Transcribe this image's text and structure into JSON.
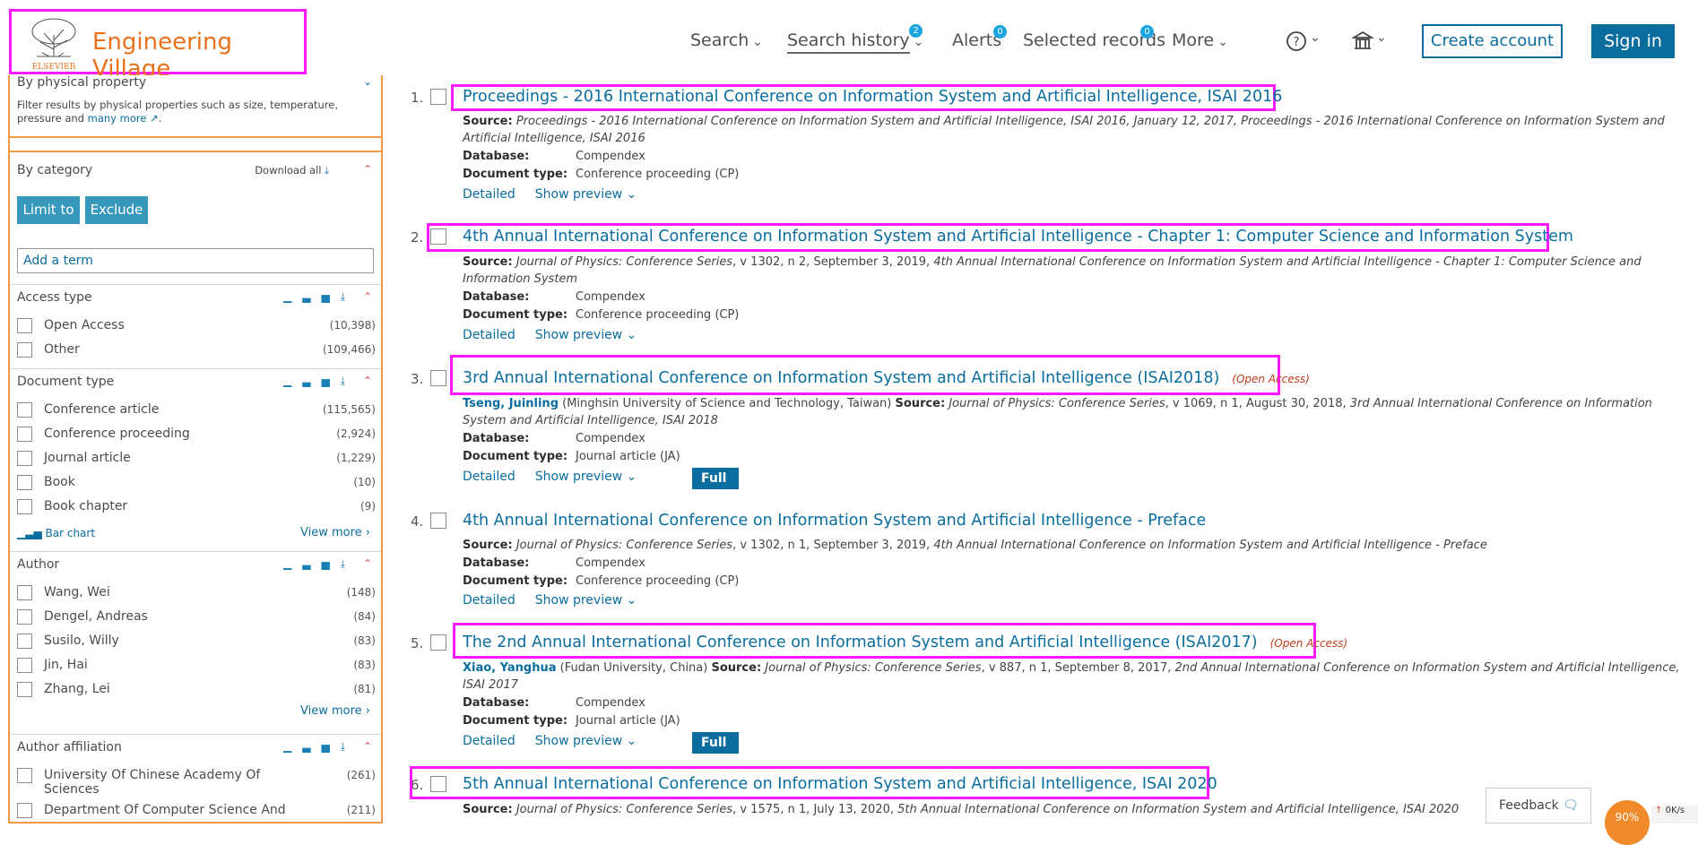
{
  "header": {
    "logo_name": "Engineering Village",
    "logo_publisher": "ELSEVIER",
    "nav": {
      "search": "Search",
      "search_history": "Search history",
      "search_history_badge": "2",
      "alerts": "Alerts",
      "alerts_badge": "0",
      "selected_records": "Selected records",
      "selected_records_badge": "0",
      "more": "More"
    },
    "create_account": "Create account",
    "sign_in": "Sign in"
  },
  "sidebar": {
    "physical": {
      "title": "By physical property",
      "description": "Filter results by physical properties such as size, temperature, pressure and",
      "link": "many more"
    },
    "category": {
      "title": "By category",
      "download_all": "Download all",
      "limit_to": "Limit to",
      "exclude": "Exclude",
      "add_term_placeholder": "Add a term"
    },
    "access_type": {
      "title": "Access type",
      "items": [
        {
          "label": "Open Access",
          "count": "(10,398)"
        },
        {
          "label": "Other",
          "count": "(109,466)"
        }
      ]
    },
    "document_type": {
      "title": "Document type",
      "items": [
        {
          "label": "Conference article",
          "count": "(115,565)"
        },
        {
          "label": "Conference proceeding",
          "count": "(2,924)"
        },
        {
          "label": "Journal article",
          "count": "(1,229)"
        },
        {
          "label": "Book",
          "count": "(10)"
        },
        {
          "label": "Book chapter",
          "count": "(9)"
        }
      ],
      "bar_chart": "Bar chart",
      "view_more": "View more"
    },
    "author": {
      "title": "Author",
      "items": [
        {
          "label": "Wang, Wei",
          "count": "(148)"
        },
        {
          "label": "Dengel, Andreas",
          "count": "(84)"
        },
        {
          "label": "Susilo, Willy",
          "count": "(83)"
        },
        {
          "label": "Jin, Hai",
          "count": "(83)"
        },
        {
          "label": "Zhang, Lei",
          "count": "(81)"
        }
      ],
      "view_more": "View more"
    },
    "affiliation": {
      "title": "Author affiliation",
      "items": [
        {
          "label": "University Of Chinese Academy Of Sciences",
          "count": "(261)"
        },
        {
          "label": "Department Of Computer Science And",
          "count": "(211)"
        }
      ]
    }
  },
  "results": {
    "labels": {
      "source": "Source:",
      "database": "Database:",
      "document_type": "Document type:",
      "detailed": "Detailed",
      "show_preview": "Show preview",
      "full_text": "Full text",
      "open_access": "Open Access"
    },
    "items": [
      {
        "num": "1.",
        "title": "Proceedings - 2016 International Conference on Information System and Artificial Intelligence, ISAI 2016",
        "source_1": "Proceedings - 2016 International Conference on Information System and Artificial Intelligence, ISAI 2016, January 12, 2017, Proceedings - 2016 International Conference on Information System and",
        "source_2": "Artificial Intelligence, ISAI 2016",
        "database": "Compendex",
        "doctype": "Conference proceeding (CP)"
      },
      {
        "num": "2.",
        "title": "4th Annual International Conference on Information System and Artificial Intelligence - Chapter 1: Computer Science and Information System",
        "source_journal": "Journal of Physics: Conference Series",
        "source_mid": ", v 1302, n 2, September 3, 2019, ",
        "source_tail": "4th Annual International Conference on Information System and Artificial Intelligence - Chapter 1: Computer Science and",
        "source_2": "Information System",
        "database": "Compendex",
        "doctype": "Conference proceeding (CP)"
      },
      {
        "num": "3.",
        "title": "3rd Annual International Conference on Information System and Artificial Intelligence (ISAI2018)",
        "author": "Tseng, Juinling",
        "affil": " (Minghsin University of Science and Technology, Taiwan) ",
        "source_journal": "Journal of Physics: Conference Series",
        "source_mid": ", v 1069, n 1, August 30, 2018, ",
        "source_tail": "3rd Annual International Conference on Information",
        "source_2": "System and Artificial Intelligence, ISAI 2018",
        "database": "Compendex",
        "doctype": "Journal article (JA)"
      },
      {
        "num": "4.",
        "title": "4th Annual International Conference on Information System and Artificial Intelligence - Preface",
        "source_journal": "Journal of Physics: Conference Series",
        "source_mid": ", v 1302, n 1, September 3, 2019, ",
        "source_tail": "4th Annual International Conference on Information System and Artificial Intelligence - Preface",
        "database": "Compendex",
        "doctype": "Conference proceeding (CP)"
      },
      {
        "num": "5.",
        "title": "The 2nd Annual International Conference on Information System and Artificial Intelligence (ISAI2017)",
        "author": "Xiao, Yanghua",
        "affil": " (Fudan University, China) ",
        "source_journal": "Journal of Physics: Conference Series",
        "source_mid": ", v 887, n 1, September 8, 2017, ",
        "source_tail": "2nd Annual International Conference on Information System and Artificial Intelligence,",
        "source_2": "ISAI 2017",
        "database": "Compendex",
        "doctype": "Journal article (JA)"
      },
      {
        "num": "6.",
        "title": "5th Annual International Conference on Information System and Artificial Intelligence, ISAI 2020",
        "source_journal": "Journal of Physics: Conference Series",
        "source_mid": ", v 1575, n 1, July 13, 2020, ",
        "source_tail": "5th Annual International Conference on Information System and Artificial Intelligence, ISAI 2020"
      }
    ]
  },
  "feedback": "Feedback",
  "progress": "90%",
  "net_speed": "0K/s",
  "colors": {
    "brand_orange": "#e9711c",
    "link_blue": "#0b6c9e",
    "highlight": "#ff1aff",
    "facet_button": "#3798bc"
  }
}
